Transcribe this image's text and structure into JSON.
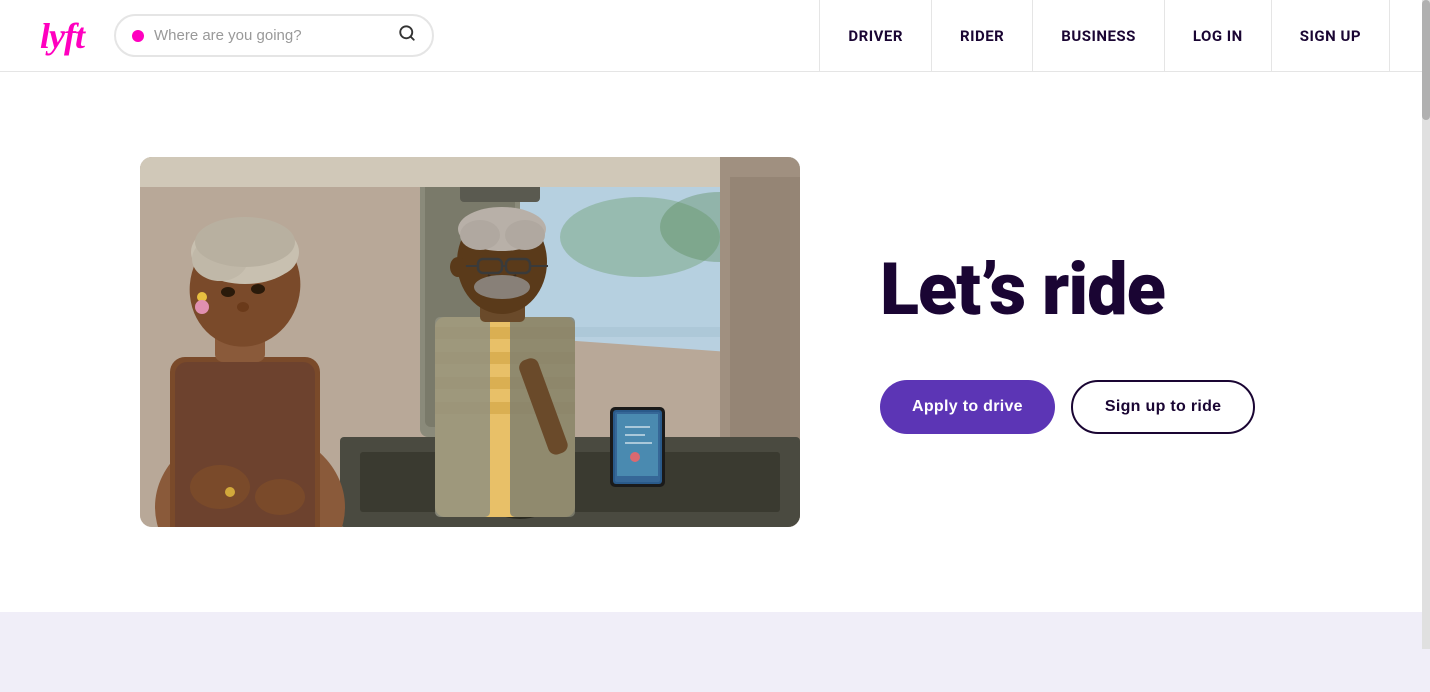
{
  "header": {
    "logo_text": "lyft",
    "search": {
      "placeholder": "Where are you going?"
    },
    "nav": [
      {
        "id": "driver",
        "label": "DRIVER"
      },
      {
        "id": "rider",
        "label": "RIDER"
      },
      {
        "id": "business",
        "label": "BUSINESS"
      },
      {
        "id": "login",
        "label": "LOG IN"
      },
      {
        "id": "signup",
        "label": "SIGN UP"
      }
    ]
  },
  "hero": {
    "headline": "Let’s ride",
    "cta_primary": "Apply to drive",
    "cta_secondary": "Sign up to ride"
  },
  "colors": {
    "lyft_pink": "#ff00bf",
    "nav_dark": "#1a0533",
    "button_purple": "#5c35b5",
    "footer_bg": "#f0eef8"
  }
}
